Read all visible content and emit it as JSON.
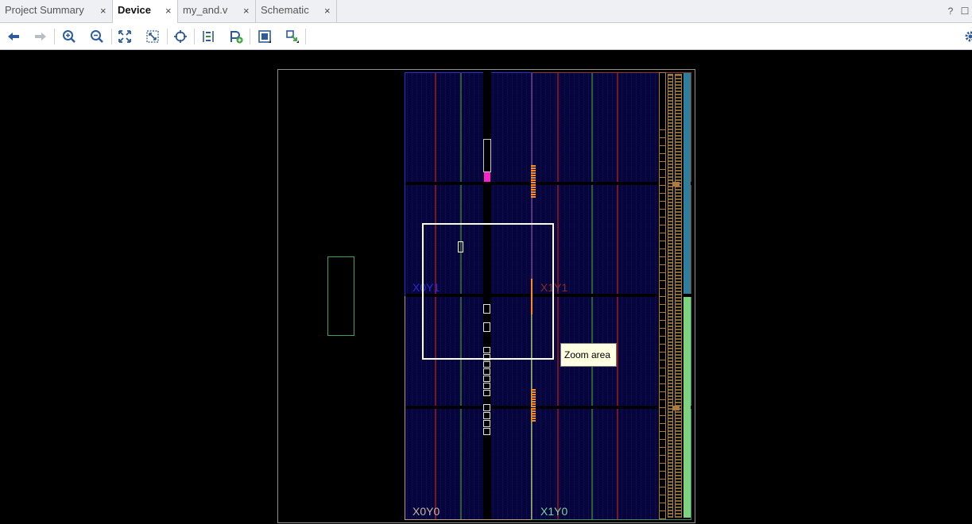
{
  "tabs": [
    {
      "label": "Project Summary",
      "active": false
    },
    {
      "label": "Device",
      "active": true
    },
    {
      "label": "my_and.v",
      "active": false
    },
    {
      "label": "Schematic",
      "active": false
    }
  ],
  "close_glyph": "×",
  "window_buttons": {
    "help": "?",
    "restore": "☐"
  },
  "toolbar_icons": [
    "back-arrow-icon",
    "forward-arrow-icon",
    "zoom-in-icon",
    "zoom-out-icon",
    "zoom-fit-icon",
    "zoom-selected-icon",
    "autofit-target-icon",
    "routing-resources-icon",
    "add-pblock-icon",
    "fixed-cells-icon",
    "toggle-view-icon",
    "settings-gear-icon"
  ],
  "device": {
    "clock_regions": [
      "X0Y1",
      "X1Y1",
      "X0Y0",
      "X1Y0"
    ],
    "tooltip": "Zoom area",
    "colors": {
      "region_top": "#2b2bd8",
      "region_bottom": "#b89a73",
      "outline": "#909090",
      "highlight_cell": "#ff1fd0",
      "io_bank_top": "#2f7f9a",
      "io_bank_bottom": "#7fd37f",
      "column_orange": "#ff8a1e",
      "column_red": "#a01818",
      "column_green": "#3b7a2e"
    }
  }
}
